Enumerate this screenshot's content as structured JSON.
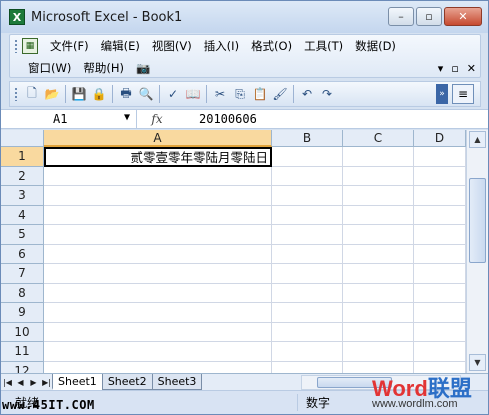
{
  "window": {
    "title": "Microsoft Excel - Book1",
    "app_icon_letter": "X",
    "minimize": "–",
    "restore": "▫",
    "close": "✕"
  },
  "menu": {
    "items": [
      "文件(F)",
      "编辑(E)",
      "视图(V)",
      "插入(I)",
      "格式(O)",
      "工具(T)",
      "数据(D)"
    ],
    "items_row2": [
      "窗口(W)",
      "帮助(H)"
    ],
    "right_controls": [
      "▾",
      "▫",
      "✕"
    ]
  },
  "toolbar": {
    "buttons": [
      {
        "name": "new-icon",
        "glyph": "🗋"
      },
      {
        "name": "open-icon",
        "glyph": "📂"
      },
      {
        "name": "save-icon",
        "glyph": "💾"
      },
      {
        "name": "permission-icon",
        "glyph": "🔒"
      },
      {
        "name": "print-icon",
        "glyph": "🖶"
      },
      {
        "name": "print-preview-icon",
        "glyph": "🔍"
      },
      {
        "name": "spelling-icon",
        "glyph": "✓"
      },
      {
        "name": "research-icon",
        "glyph": "📖"
      },
      {
        "name": "cut-icon",
        "glyph": "✂"
      },
      {
        "name": "copy-icon",
        "glyph": "⎘"
      },
      {
        "name": "paste-icon",
        "glyph": "📋"
      },
      {
        "name": "format-painter-icon",
        "glyph": "🖌"
      },
      {
        "name": "undo-icon",
        "glyph": "↶"
      },
      {
        "name": "redo-icon",
        "glyph": "↷"
      }
    ],
    "align_glyph": "≡"
  },
  "formula_bar": {
    "name_box": "A1",
    "fx_label": "fx",
    "value": "20100606"
  },
  "grid": {
    "columns": [
      "A",
      "B",
      "C",
      "D"
    ],
    "rows": [
      "1",
      "2",
      "3",
      "4",
      "5",
      "6",
      "7",
      "8",
      "9",
      "10",
      "11",
      "12"
    ],
    "cell_a1": "贰零壹零年零陆月零陆日"
  },
  "sheets": [
    "Sheet1",
    "Sheet2",
    "Sheet3"
  ],
  "status": {
    "ready": "就绪",
    "num": "数字"
  },
  "watermarks": {
    "site": "www.45IT.COM",
    "brand_part1": "Word",
    "brand_part2": "联盟",
    "brand_url": "www.wordlm.com"
  }
}
